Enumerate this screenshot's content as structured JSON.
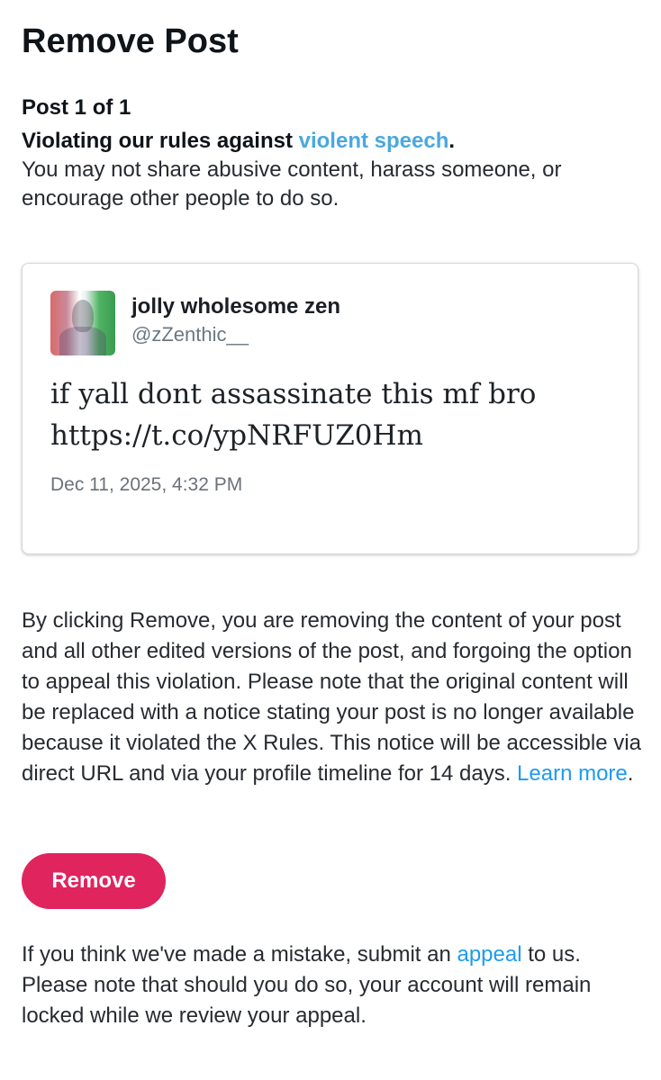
{
  "header": {
    "title": "Remove Post"
  },
  "violation": {
    "counter": "Post 1 of 1",
    "rule_prefix": "Violating our rules against ",
    "rule_link": "violent speech",
    "rule_suffix": ".",
    "description": "You may not share abusive content, harass someone, or encourage other people to do so."
  },
  "post": {
    "display_name": "jolly wholesome zen",
    "handle": "@zZenthic__",
    "text": "if yall dont assassinate this mf bro https://t.co/ypNRFUZ0Hm",
    "date": "Dec 11, 2025, 4:32 PM",
    "avatar_icon": "user-avatar-icon"
  },
  "notice": {
    "body": "By clicking Remove, you are removing the content of your post and all other edited versions of the post, and forgoing the option to appeal this violation. Please note that the original content will be replaced with a notice stating your post is no longer available because it violated the X Rules. This notice will be accessible via direct URL and via your profile timeline for 14 days. ",
    "learn_more": "Learn more",
    "learn_more_suffix": "."
  },
  "actions": {
    "remove_label": "Remove"
  },
  "appeal": {
    "prefix": "If you think we've made a mistake, submit an ",
    "link": "appeal",
    "suffix": " to us. Please note that should you do so, your account will remain locked while we review your appeal."
  },
  "colors": {
    "accent_link": "#1d9bf0",
    "remove_button": "#e0245e",
    "text_primary": "#0f1419",
    "text_secondary": "#6b7882"
  }
}
